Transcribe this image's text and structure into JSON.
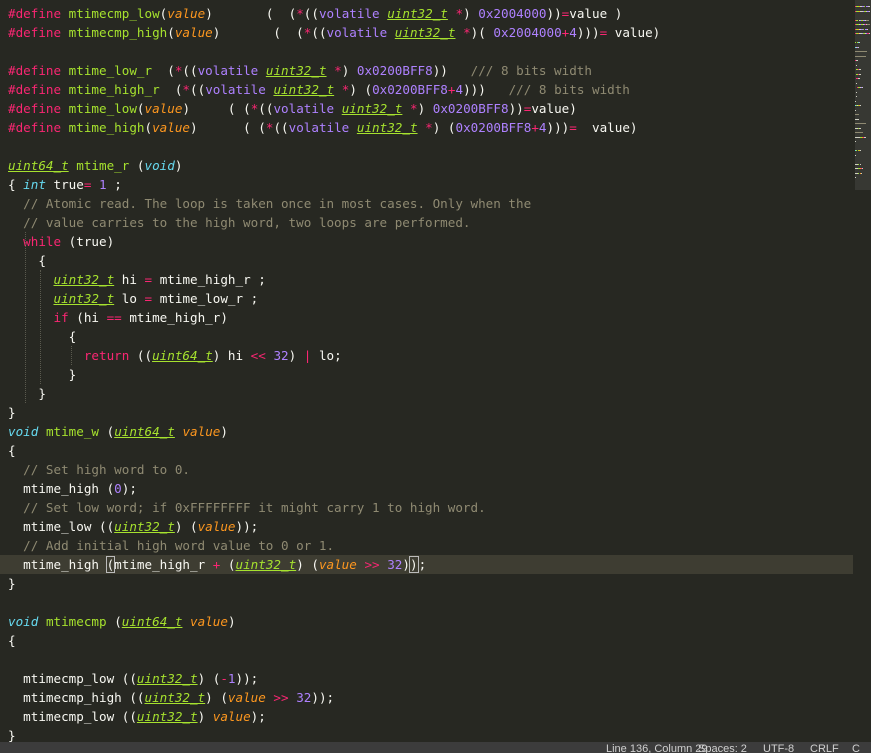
{
  "editor": {
    "lines": [
      [
        [
          "dir",
          "#define"
        ],
        [
          "tx",
          " "
        ],
        [
          "fn",
          "mtimecmp_low"
        ],
        [
          "tx",
          "("
        ],
        [
          "pa",
          "value"
        ],
        [
          "tx",
          ")       (  ("
        ],
        [
          "op",
          "*"
        ],
        [
          "tx",
          "(("
        ],
        [
          "vo",
          "volatile"
        ],
        [
          "tx",
          " "
        ],
        [
          "ut",
          "uint32_t"
        ],
        [
          "tx",
          " "
        ],
        [
          "op",
          "*"
        ],
        [
          "tx",
          ") "
        ],
        [
          "nm",
          "0x2004000"
        ],
        [
          "tx",
          "))"
        ],
        [
          "op",
          "="
        ],
        [
          "tx",
          "value )"
        ]
      ],
      [
        [
          "dir",
          "#define"
        ],
        [
          "tx",
          " "
        ],
        [
          "fn",
          "mtimecmp_high"
        ],
        [
          "tx",
          "("
        ],
        [
          "pa",
          "value"
        ],
        [
          "tx",
          ")       (  ("
        ],
        [
          "op",
          "*"
        ],
        [
          "tx",
          "(("
        ],
        [
          "vo",
          "volatile"
        ],
        [
          "tx",
          " "
        ],
        [
          "ut",
          "uint32_t"
        ],
        [
          "tx",
          " "
        ],
        [
          "op",
          "*"
        ],
        [
          "tx",
          ")( "
        ],
        [
          "nm",
          "0x2004000"
        ],
        [
          "op",
          "+"
        ],
        [
          "nm",
          "4"
        ],
        [
          "tx",
          ")))"
        ],
        [
          "op",
          "="
        ],
        [
          "tx",
          " value)"
        ]
      ],
      [],
      [
        [
          "dir",
          "#define"
        ],
        [
          "tx",
          " "
        ],
        [
          "fn",
          "mtime_low_r"
        ],
        [
          "tx",
          "  ("
        ],
        [
          "op",
          "*"
        ],
        [
          "tx",
          "(("
        ],
        [
          "vo",
          "volatile"
        ],
        [
          "tx",
          " "
        ],
        [
          "ut",
          "uint32_t"
        ],
        [
          "tx",
          " "
        ],
        [
          "op",
          "*"
        ],
        [
          "tx",
          ") "
        ],
        [
          "nm",
          "0x0200BFF8"
        ],
        [
          "tx",
          "))   "
        ],
        [
          "cm",
          "/// 8 bits width"
        ]
      ],
      [
        [
          "dir",
          "#define"
        ],
        [
          "tx",
          " "
        ],
        [
          "fn",
          "mtime_high_r"
        ],
        [
          "tx",
          "  ("
        ],
        [
          "op",
          "*"
        ],
        [
          "tx",
          "(("
        ],
        [
          "vo",
          "volatile"
        ],
        [
          "tx",
          " "
        ],
        [
          "ut",
          "uint32_t"
        ],
        [
          "tx",
          " "
        ],
        [
          "op",
          "*"
        ],
        [
          "tx",
          ") ("
        ],
        [
          "nm",
          "0x0200BFF8"
        ],
        [
          "op",
          "+"
        ],
        [
          "nm",
          "4"
        ],
        [
          "tx",
          ")))   "
        ],
        [
          "cm",
          "/// 8 bits width"
        ]
      ],
      [
        [
          "dir",
          "#define"
        ],
        [
          "tx",
          " "
        ],
        [
          "fn",
          "mtime_low"
        ],
        [
          "tx",
          "("
        ],
        [
          "pa",
          "value"
        ],
        [
          "tx",
          ")     ( ("
        ],
        [
          "op",
          "*"
        ],
        [
          "tx",
          "(("
        ],
        [
          "vo",
          "volatile"
        ],
        [
          "tx",
          " "
        ],
        [
          "ut",
          "uint32_t"
        ],
        [
          "tx",
          " "
        ],
        [
          "op",
          "*"
        ],
        [
          "tx",
          ") "
        ],
        [
          "nm",
          "0x0200BFF8"
        ],
        [
          "tx",
          "))"
        ],
        [
          "op",
          "="
        ],
        [
          "tx",
          "value)"
        ]
      ],
      [
        [
          "dir",
          "#define"
        ],
        [
          "tx",
          " "
        ],
        [
          "fn",
          "mtime_high"
        ],
        [
          "tx",
          "("
        ],
        [
          "pa",
          "value"
        ],
        [
          "tx",
          ")      ( ("
        ],
        [
          "op",
          "*"
        ],
        [
          "tx",
          "(("
        ],
        [
          "vo",
          "volatile"
        ],
        [
          "tx",
          " "
        ],
        [
          "ut",
          "uint32_t"
        ],
        [
          "tx",
          " "
        ],
        [
          "op",
          "*"
        ],
        [
          "tx",
          ") ("
        ],
        [
          "nm",
          "0x0200BFF8"
        ],
        [
          "op",
          "+"
        ],
        [
          "nm",
          "4"
        ],
        [
          "tx",
          ")))"
        ],
        [
          "op",
          "="
        ],
        [
          "tx",
          "  value)"
        ]
      ],
      [],
      [
        [
          "ut",
          "uint64_t"
        ],
        [
          "tx",
          " "
        ],
        [
          "fn",
          "mtime_r"
        ],
        [
          "tx",
          " ("
        ],
        [
          "ty",
          "void"
        ],
        [
          "tx",
          ")"
        ]
      ],
      [
        [
          "tx",
          "{ "
        ],
        [
          "ty",
          "int"
        ],
        [
          "tx",
          " true"
        ],
        [
          "op",
          "="
        ],
        [
          "tx",
          " "
        ],
        [
          "nm",
          "1"
        ],
        [
          "tx",
          " ;"
        ]
      ],
      [
        [
          "tx",
          "  "
        ],
        [
          "cm",
          "// Atomic read. The loop is taken once in most cases. Only when the"
        ]
      ],
      [
        [
          "tx",
          "  "
        ],
        [
          "cm",
          "// value carries to the high word, two loops are performed."
        ]
      ],
      [
        [
          "tx",
          "  "
        ],
        [
          "kw",
          "while"
        ],
        [
          "tx",
          " (true)"
        ]
      ],
      [
        [
          "tx",
          "    {"
        ]
      ],
      [
        [
          "tx",
          "      "
        ],
        [
          "ut",
          "uint32_t"
        ],
        [
          "tx",
          " hi "
        ],
        [
          "op",
          "="
        ],
        [
          "tx",
          " mtime_high_r ;"
        ]
      ],
      [
        [
          "tx",
          "      "
        ],
        [
          "ut",
          "uint32_t"
        ],
        [
          "tx",
          " lo "
        ],
        [
          "op",
          "="
        ],
        [
          "tx",
          " mtime_low_r ;"
        ]
      ],
      [
        [
          "tx",
          "      "
        ],
        [
          "kw",
          "if"
        ],
        [
          "tx",
          " (hi "
        ],
        [
          "op",
          "=="
        ],
        [
          "tx",
          " mtime_high_r)"
        ]
      ],
      [
        [
          "tx",
          "        {"
        ]
      ],
      [
        [
          "tx",
          "          "
        ],
        [
          "kw",
          "return"
        ],
        [
          "tx",
          " (("
        ],
        [
          "ut",
          "uint64_t"
        ],
        [
          "tx",
          ") hi "
        ],
        [
          "op",
          "<<"
        ],
        [
          "tx",
          " "
        ],
        [
          "nm",
          "32"
        ],
        [
          "tx",
          ") "
        ],
        [
          "op",
          "|"
        ],
        [
          "tx",
          " lo;"
        ]
      ],
      [
        [
          "tx",
          "        }"
        ]
      ],
      [
        [
          "tx",
          "    }"
        ]
      ],
      [
        [
          "tx",
          "}"
        ]
      ],
      [
        [
          "ty",
          "void"
        ],
        [
          "tx",
          " "
        ],
        [
          "fn",
          "mtime_w"
        ],
        [
          "tx",
          " ("
        ],
        [
          "ut",
          "uint64_t"
        ],
        [
          "tx",
          " "
        ],
        [
          "pa",
          "value"
        ],
        [
          "tx",
          ")"
        ]
      ],
      [
        [
          "tx",
          "{"
        ]
      ],
      [
        [
          "tx",
          "  "
        ],
        [
          "cm",
          "// Set high word to 0."
        ]
      ],
      [
        [
          "tx",
          "  mtime_high ("
        ],
        [
          "nm",
          "0"
        ],
        [
          "tx",
          ");"
        ]
      ],
      [
        [
          "tx",
          "  "
        ],
        [
          "cm",
          "// Set low word; if 0xFFFFFFFF it might carry 1 to high word."
        ]
      ],
      [
        [
          "tx",
          "  mtime_low (("
        ],
        [
          "ut",
          "uint32_t"
        ],
        [
          "tx",
          ") ("
        ],
        [
          "pa",
          "value"
        ],
        [
          "tx",
          "));"
        ]
      ],
      [
        [
          "tx",
          "  "
        ],
        [
          "cm",
          "// Add initial high word value to 0 or 1."
        ]
      ],
      [
        [
          "tx",
          "  mtime_high "
        ],
        [
          "br",
          "("
        ],
        [
          "tx",
          "mtime_high_r "
        ],
        [
          "op",
          "+"
        ],
        [
          "tx",
          " ("
        ],
        [
          "ut",
          "uint32_t"
        ],
        [
          "tx",
          ") ("
        ],
        [
          "pa",
          "value"
        ],
        [
          "tx",
          " "
        ],
        [
          "op",
          ">>"
        ],
        [
          "tx",
          " "
        ],
        [
          "nm",
          "32"
        ],
        [
          "tx",
          ")"
        ],
        [
          "br",
          ")"
        ],
        [
          "caret",
          ""
        ],
        [
          "tx",
          ";"
        ]
      ],
      [
        [
          "tx",
          "}"
        ]
      ],
      [],
      [
        [
          "ty",
          "void"
        ],
        [
          "tx",
          " "
        ],
        [
          "fn",
          "mtimecmp"
        ],
        [
          "tx",
          " ("
        ],
        [
          "ut",
          "uint64_t"
        ],
        [
          "tx",
          " "
        ],
        [
          "pa",
          "value"
        ],
        [
          "tx",
          ")"
        ]
      ],
      [
        [
          "tx",
          "{"
        ]
      ],
      [],
      [
        [
          "tx",
          "  mtimecmp_low (("
        ],
        [
          "ut",
          "uint32_t"
        ],
        [
          "tx",
          ") ("
        ],
        [
          "op",
          "-"
        ],
        [
          "nm",
          "1"
        ],
        [
          "tx",
          "));"
        ]
      ],
      [
        [
          "tx",
          "  mtimecmp_high (("
        ],
        [
          "ut",
          "uint32_t"
        ],
        [
          "tx",
          ") ("
        ],
        [
          "pa",
          "value"
        ],
        [
          "tx",
          " "
        ],
        [
          "op",
          ">>"
        ],
        [
          "tx",
          " "
        ],
        [
          "nm",
          "32"
        ],
        [
          "tx",
          "));"
        ]
      ],
      [
        [
          "tx",
          "  mtimecmp_low (("
        ],
        [
          "ut",
          "uint32_t"
        ],
        [
          "tx",
          ") "
        ],
        [
          "pa",
          "value"
        ],
        [
          "tx",
          ");"
        ]
      ],
      [
        [
          "tx",
          "}"
        ]
      ]
    ],
    "current_line": 29
  },
  "statusbar": {
    "position": "Line 136, Column 29",
    "indentation": "Spaces: 2",
    "encoding": "UTF-8",
    "line_endings": "CRLF",
    "syntax": "C"
  }
}
